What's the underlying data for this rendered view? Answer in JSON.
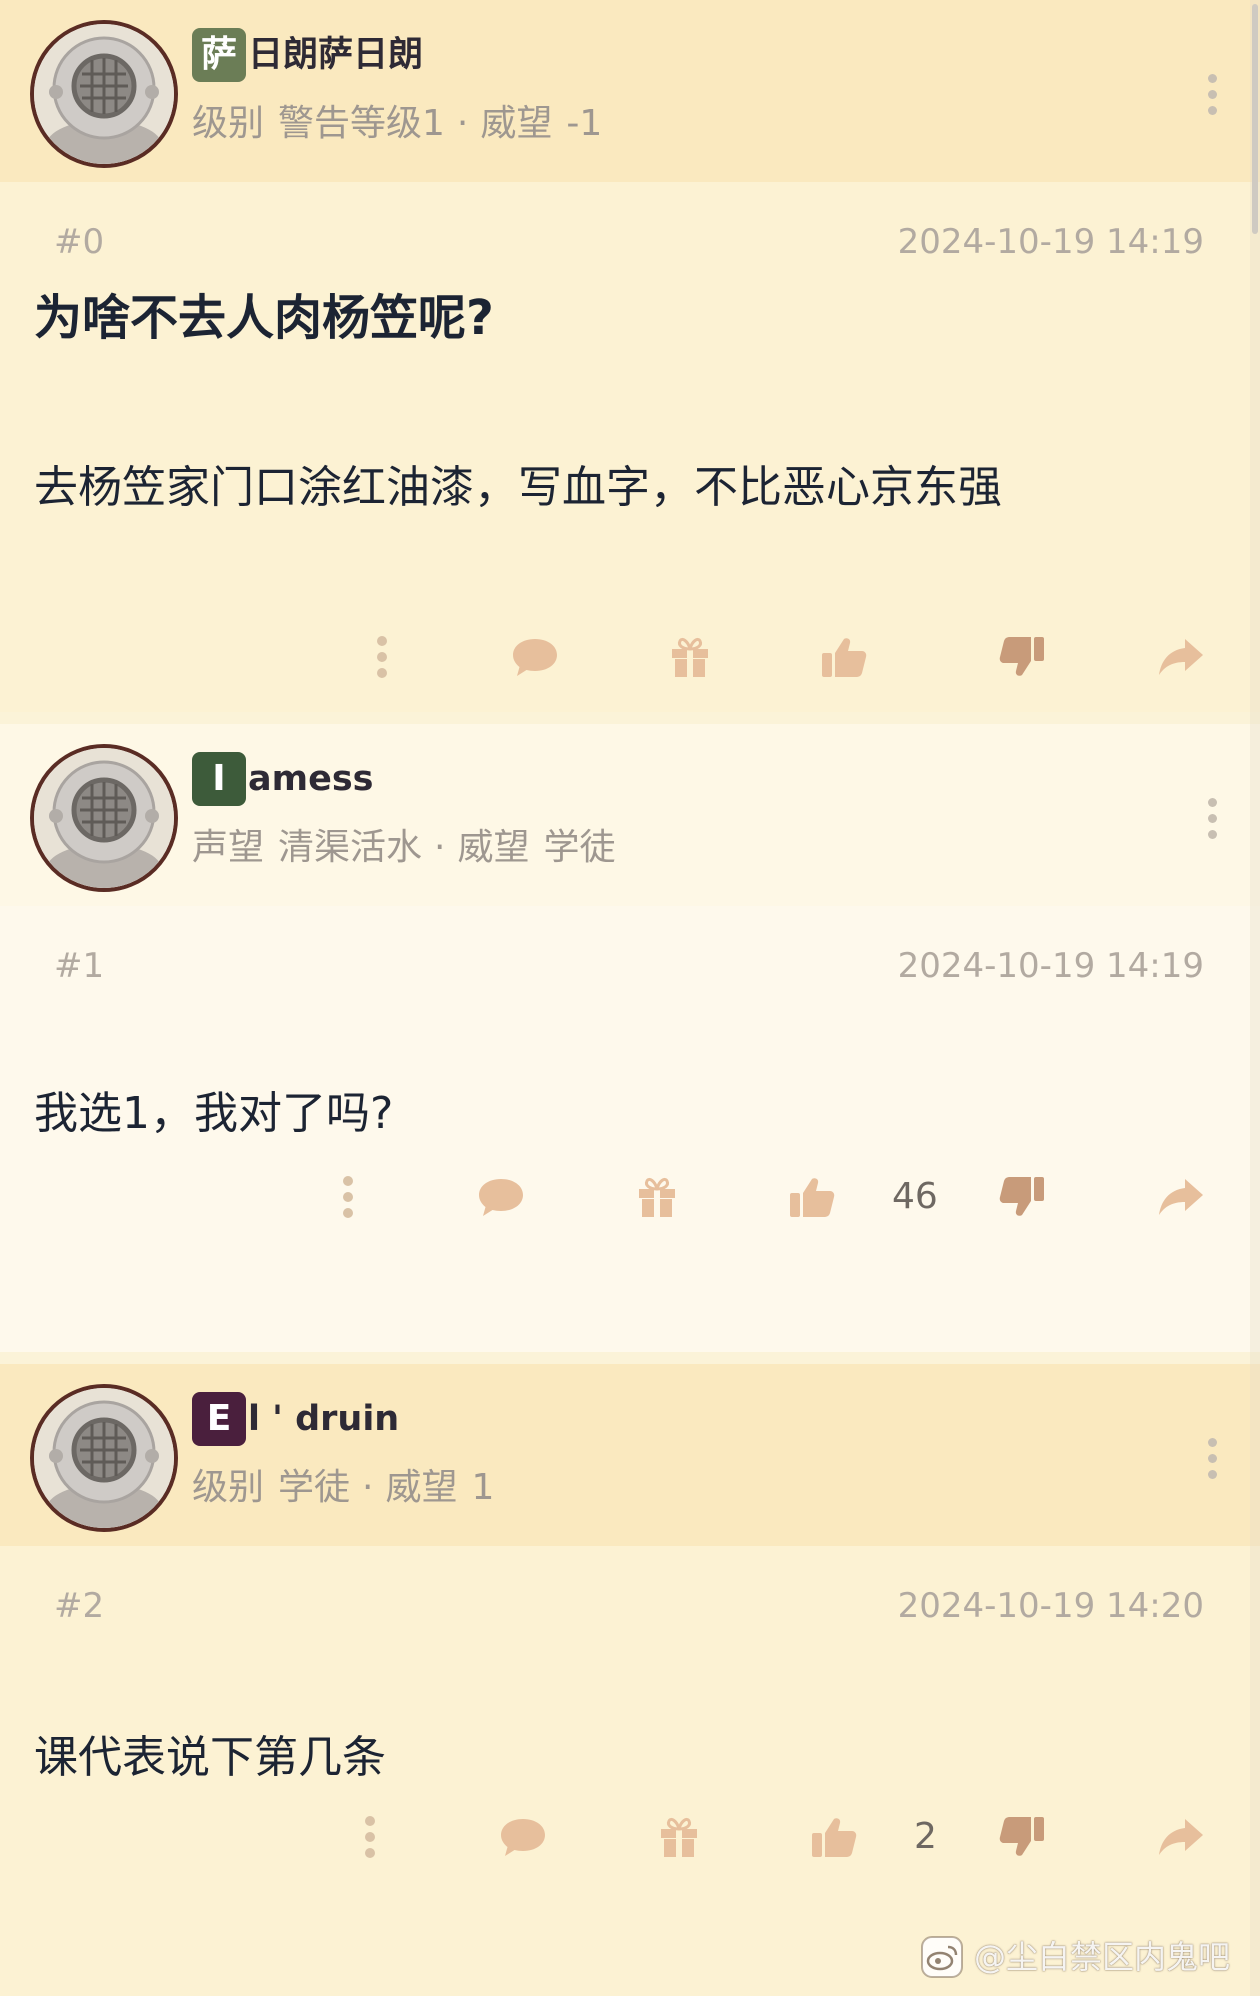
{
  "posts": [
    {
      "username_badge": "萨",
      "username_rest": "日朗萨日朗",
      "badge_color": "#6b7d56",
      "meta_label_1": "级别",
      "meta_value_1": "警告等级1",
      "meta_separator": "·",
      "meta_label_2": "威望",
      "meta_value_2": "-1",
      "floor": "#0",
      "time": "2024-10-19 14:19",
      "title": "为啥不去人肉杨笠呢?",
      "content": "去杨笠家门口涂红油漆，写血字，不比恶心京东强",
      "like_count": ""
    },
    {
      "username_badge": "I",
      "username_rest": "amess",
      "badge_color": "#3d5b3a",
      "meta_label_1": "声望",
      "meta_value_1": "清渠活水",
      "meta_separator": "·",
      "meta_label_2": "威望",
      "meta_value_2": "学徒",
      "floor": "#1",
      "time": "2024-10-19 14:19",
      "title": "",
      "content": "我选1，我对了吗?",
      "like_count": "46"
    },
    {
      "username_badge": "E",
      "username_rest": "l ' druin",
      "badge_color": "#4a1f3d",
      "meta_label_1": "级别",
      "meta_value_1": "学徒",
      "meta_separator": "·",
      "meta_label_2": "威望",
      "meta_value_2": "1",
      "floor": "#2",
      "time": "2024-10-19 14:20",
      "title": "",
      "content": "课代表说下第几条",
      "like_count": "2"
    }
  ],
  "icons": {
    "avatar": "diving-helmet-avatar-icon",
    "more": "more-vertical-icon",
    "actions": [
      "more-vertical-icon",
      "comment-icon",
      "gift-icon",
      "thumbs-up-icon",
      "thumbs-down-icon",
      "share-icon"
    ]
  },
  "watermark": {
    "text": "@尘白禁区内鬼吧",
    "icon": "weibo-logo-icon"
  },
  "colors": {
    "header_bg": "#fae9bf",
    "body_bg": "#fcf2d3",
    "action_icon": "#c99a72",
    "meta_text": "#9e9790",
    "avatar_border": "#5a2c24"
  }
}
